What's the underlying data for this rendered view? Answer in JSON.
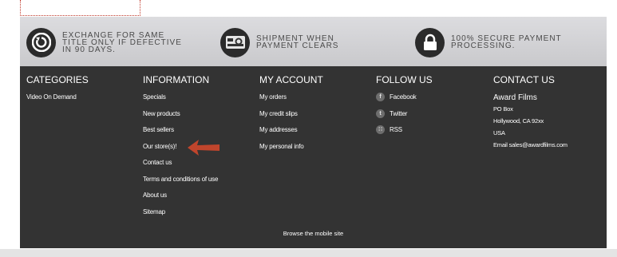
{
  "reassurance": [
    {
      "icon": "exchange-icon",
      "text": "Exchange for same title only if defective in 90 days."
    },
    {
      "icon": "shipment-icon",
      "text": "Shipment when payment clears"
    },
    {
      "icon": "lock-icon",
      "text": "100% secure payment processing."
    }
  ],
  "categories": {
    "title": "CATEGORIES",
    "items": [
      "Video On Demand"
    ]
  },
  "information": {
    "title": "INFORMATION",
    "items": [
      "Specials",
      "New products",
      "Best sellers",
      "Our store(s)!",
      "Contact us",
      "Terms and conditions of use",
      "About us",
      "Sitemap"
    ]
  },
  "account": {
    "title": "MY ACCOUNT",
    "items": [
      "My orders",
      "My credit slips",
      "My addresses",
      "My personal info"
    ]
  },
  "follow": {
    "title": "FOLLOW US",
    "items": [
      {
        "label": "Facebook",
        "icon": "facebook-icon",
        "glyph": "f"
      },
      {
        "label": "Twitter",
        "icon": "twitter-icon",
        "glyph": "t"
      },
      {
        "label": "RSS",
        "icon": "rss-icon",
        "glyph": "∷"
      }
    ]
  },
  "contact": {
    "title": "CONTACT US",
    "company": "Award Films",
    "lines": [
      "PO Box",
      "Hollywood, CA  92xx",
      "USA",
      "Email sales@awardfilms.com"
    ]
  },
  "browse_mobile": "Browse the mobile site",
  "colors": {
    "footer_bg": "#333333",
    "band_bg": "#d3d3d6",
    "arrow": "#c0452c"
  }
}
